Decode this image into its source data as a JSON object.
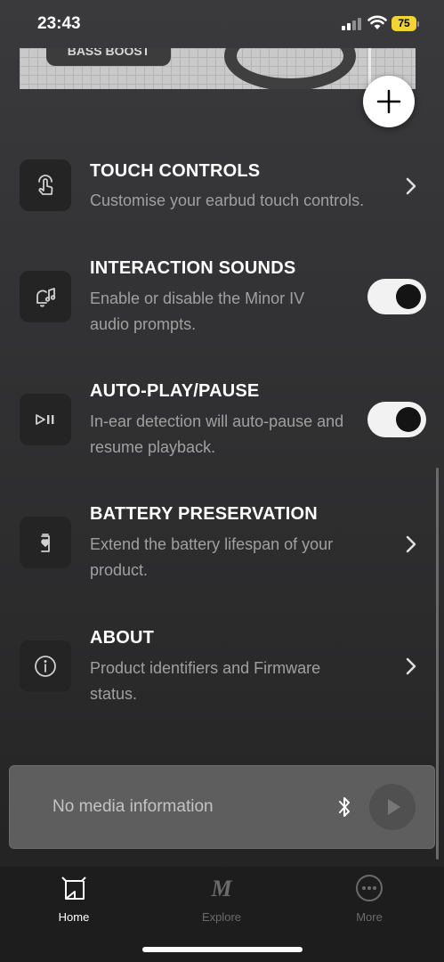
{
  "status_bar": {
    "time": "23:43",
    "battery": "75"
  },
  "product": {
    "label": "BASS BOOST"
  },
  "settings": [
    {
      "title": "TOUCH CONTROLS",
      "description": "Customise your earbud touch controls.",
      "icon": "touch-icon",
      "control": "chevron"
    },
    {
      "title": "INTERACTION SOUNDS",
      "description": "Enable or disable the Minor IV audio prompts.",
      "icon": "sound-notification-icon",
      "control": "toggle",
      "enabled": true
    },
    {
      "title": "AUTO-PLAY/PAUSE",
      "description": "In-ear detection will auto-pause and resume playback.",
      "icon": "play-pause-icon",
      "control": "toggle",
      "enabled": true
    },
    {
      "title": "BATTERY PRESERVATION",
      "description": "Extend the battery lifespan of your product.",
      "icon": "battery-heart-icon",
      "control": "chevron"
    },
    {
      "title": "ABOUT",
      "description": "Product identifiers and Firmware status.",
      "icon": "info-icon",
      "control": "chevron"
    }
  ],
  "player": {
    "text": "No media information"
  },
  "tabs": [
    {
      "label": "Home",
      "icon": "home-icon",
      "active": true
    },
    {
      "label": "Explore",
      "icon": "marshall-logo-icon",
      "active": false
    },
    {
      "label": "More",
      "icon": "more-icon",
      "active": false
    }
  ],
  "colors": {
    "active_tab": "#ffffff",
    "inactive_tab": "#6b6b6b",
    "battery": "#f4d433"
  }
}
